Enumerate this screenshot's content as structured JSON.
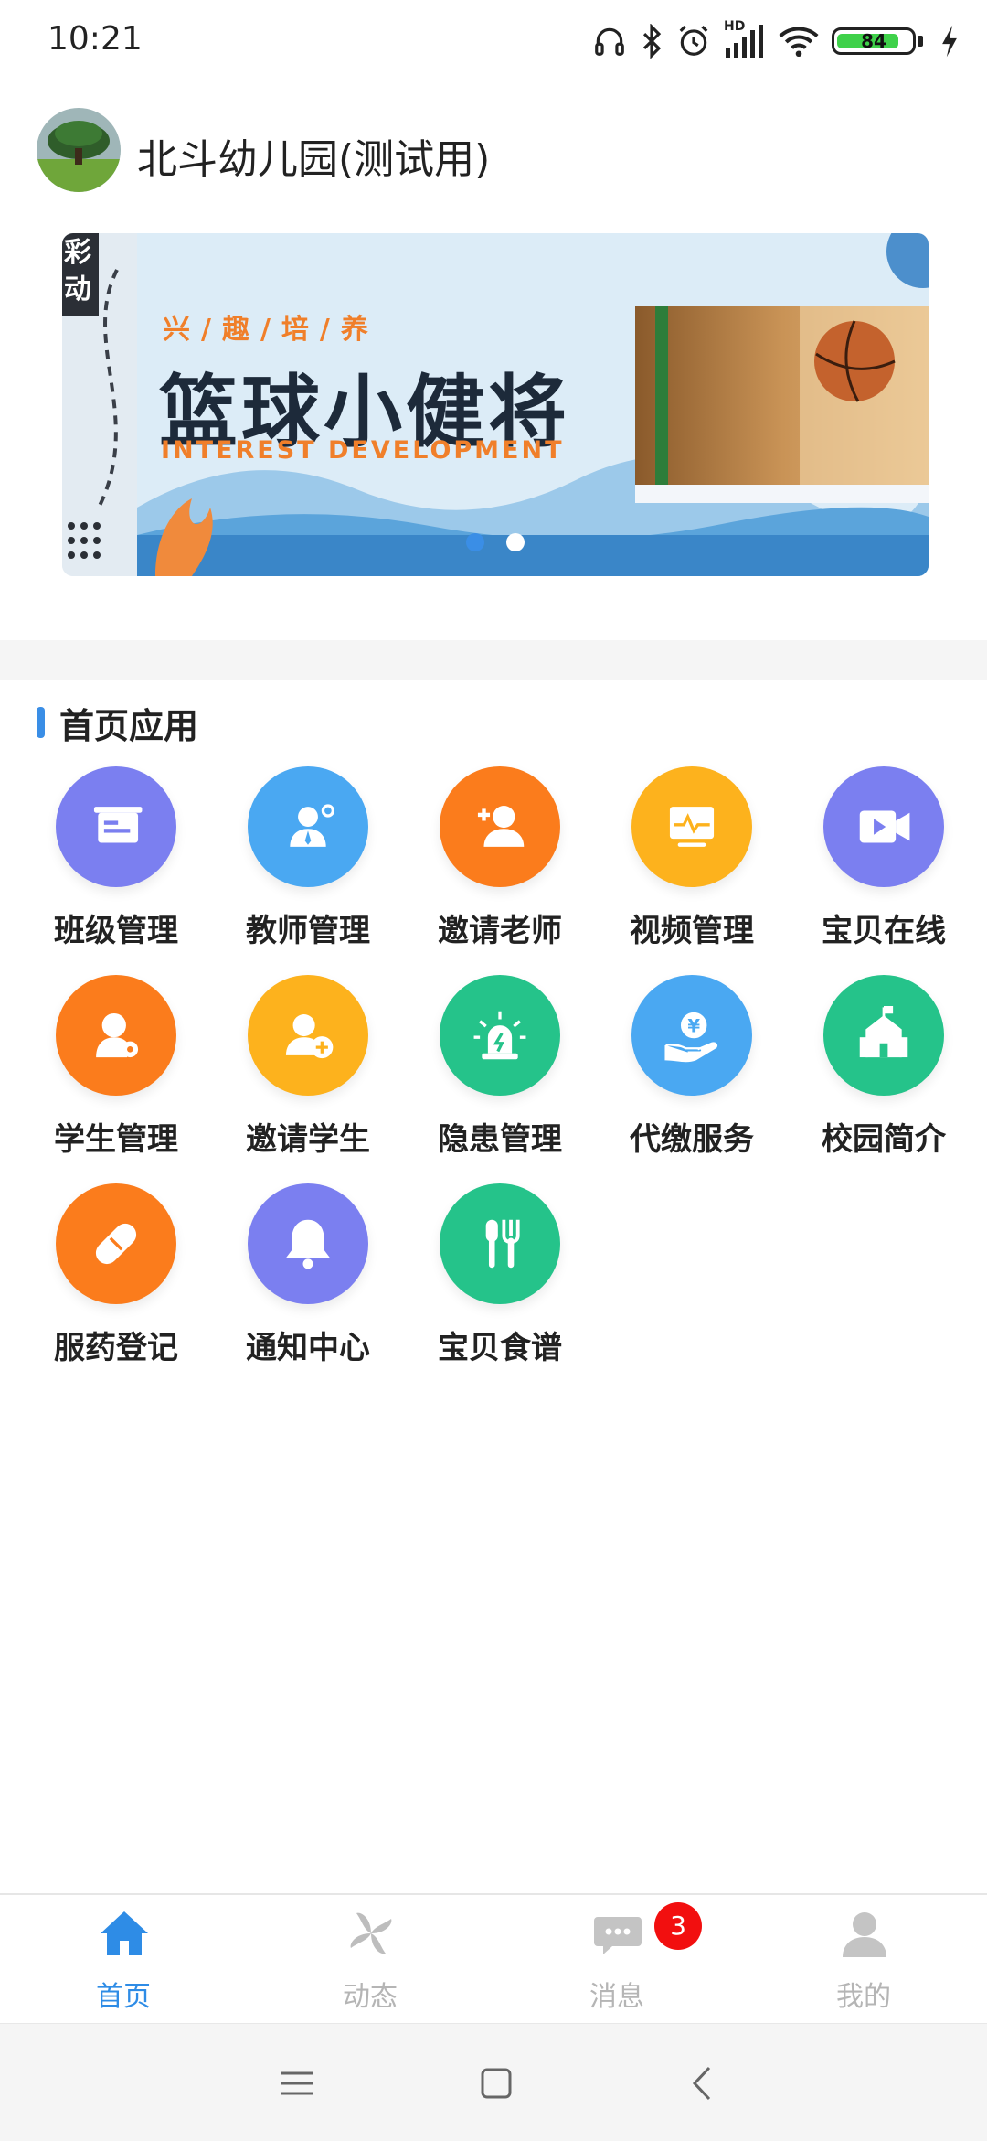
{
  "status_bar": {
    "time": "10:21",
    "battery": "84",
    "hd_label": "HD"
  },
  "header": {
    "school_name": "北斗幼儿园(测试用)"
  },
  "banner": {
    "subtitle": "兴/趣/培/养",
    "title": "篮球小健将",
    "english": "INTEREST DEVELOPMENT",
    "side_text": "彩动",
    "page_count": 2,
    "active_page": 1
  },
  "section": {
    "title": "首页应用"
  },
  "apps": [
    {
      "label": "班级管理",
      "icon": "class-board-icon",
      "color": "#7b7ff0"
    },
    {
      "label": "教师管理",
      "icon": "teacher-icon",
      "color": "#4aa8f2"
    },
    {
      "label": "邀请老师",
      "icon": "invite-teacher-icon",
      "color": "#fb7c1c"
    },
    {
      "label": "视频管理",
      "icon": "video-monitor-icon",
      "color": "#fdb21d"
    },
    {
      "label": "宝贝在线",
      "icon": "video-camera-icon",
      "color": "#7b7ff0"
    },
    {
      "label": "学生管理",
      "icon": "student-settings-icon",
      "color": "#fb7c1c"
    },
    {
      "label": "邀请学生",
      "icon": "invite-student-icon",
      "color": "#fdb21d"
    },
    {
      "label": "隐患管理",
      "icon": "alarm-icon",
      "color": "#25c38a"
    },
    {
      "label": "代缴服务",
      "icon": "payment-hand-icon",
      "color": "#4aa8f2"
    },
    {
      "label": "校园简介",
      "icon": "school-building-icon",
      "color": "#25c38a"
    },
    {
      "label": "服药登记",
      "icon": "pill-icon",
      "color": "#fb7c1c"
    },
    {
      "label": "通知中心",
      "icon": "bell-icon",
      "color": "#7b7ff0"
    },
    {
      "label": "宝贝食谱",
      "icon": "utensils-icon",
      "color": "#25c38a"
    }
  ],
  "tabbar": {
    "tabs": [
      {
        "label": "首页",
        "icon": "home-icon",
        "active": true
      },
      {
        "label": "动态",
        "icon": "pinwheel-icon",
        "active": false
      },
      {
        "label": "消息",
        "icon": "chat-icon",
        "active": false,
        "badge": "3"
      },
      {
        "label": "我的",
        "icon": "person-icon",
        "active": false
      }
    ]
  },
  "colors": {
    "accent": "#2e8ce6",
    "inactive": "#b5b5b5",
    "badge": "#f20f0f"
  }
}
